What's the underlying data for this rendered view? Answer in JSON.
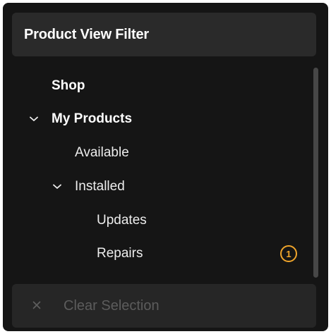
{
  "header": {
    "title": "Product View Filter"
  },
  "tree": {
    "items": [
      {
        "label": "Shop"
      },
      {
        "label": "My Products"
      },
      {
        "label": "Available"
      },
      {
        "label": "Installed"
      },
      {
        "label": "Updates"
      },
      {
        "label": "Repairs",
        "badge": "1"
      }
    ]
  },
  "footer": {
    "clear_label": "Clear Selection"
  },
  "icons": {
    "expanded": "chevron-down-icon",
    "clear": "close-icon"
  },
  "colors": {
    "panel": "#151515",
    "header": "#2a2a2a",
    "badge": "#f0a52b",
    "text": "#ededed",
    "disabled": "#5c5c5c"
  }
}
